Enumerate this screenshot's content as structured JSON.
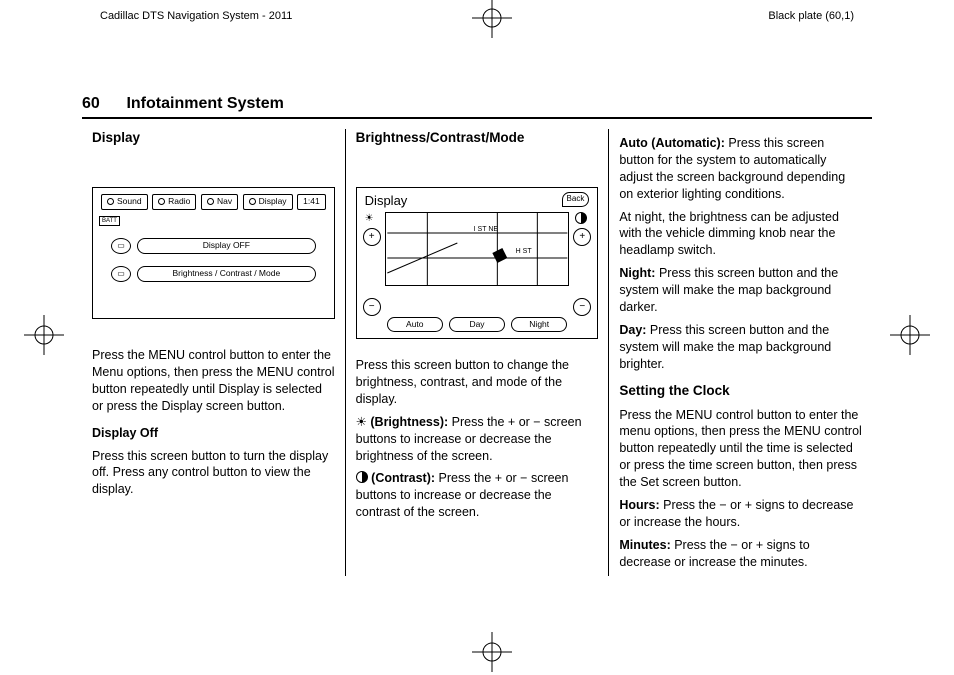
{
  "header": {
    "left": "Cadillac DTS Navigation System - 2011",
    "right": "Black plate (60,1)"
  },
  "section": {
    "pageno": "60",
    "title": "Infotainment System"
  },
  "col1": {
    "h_display": "Display",
    "screen": {
      "tabs": [
        "Sound",
        "Radio",
        "Nav",
        "Display",
        "1:41"
      ],
      "row1": "Display OFF",
      "row2": "Brightness / Contrast / Mode"
    },
    "p1": "Press the MENU control button to enter the Menu options, then press the MENU control button repeatedly until Display is selected or press the Display screen button.",
    "h_off": "Display Off",
    "p2": "Press this screen button to turn the display off. Press any control button to view the display."
  },
  "col2": {
    "h": "Brightness/Contrast/Mode",
    "screen": {
      "title": "Display",
      "back": "Back",
      "map_labels": [
        "I ST NE",
        "H ST"
      ],
      "bottom": [
        "Auto",
        "Day",
        "Night"
      ]
    },
    "p1": "Press this screen button to change the brightness, contrast, and mode of the display.",
    "b_label": "(Brightness):",
    "b_text": "Press the + or − screen buttons to increase or decrease the brightness of the screen.",
    "c_label": "(Contrast):",
    "c_text": "Press the + or − screen buttons to increase or decrease the contrast of the screen."
  },
  "col3": {
    "auto_label": "Auto (Automatic):",
    "auto_text": "Press this screen button for the system to automatically adjust the screen background depending on exterior lighting conditions.",
    "p_night_adj": "At night, the brightness can be adjusted with the vehicle dimming knob near the headlamp switch.",
    "night_label": "Night:",
    "night_text": "Press this screen button and the system will make the map background darker.",
    "day_label": "Day:",
    "day_text": "Press this screen button and the system will make the map background brighter.",
    "h_clock": "Setting the Clock",
    "p_clock": "Press the MENU control button to enter the menu options, then press the MENU control button repeatedly until the time is selected or press the time screen button, then press the Set screen button.",
    "hours_label": "Hours:",
    "hours_text": "Press the − or + signs to decrease or increase the hours.",
    "min_label": "Minutes:",
    "min_text": "Press the − or + signs to decrease or increase the minutes."
  }
}
